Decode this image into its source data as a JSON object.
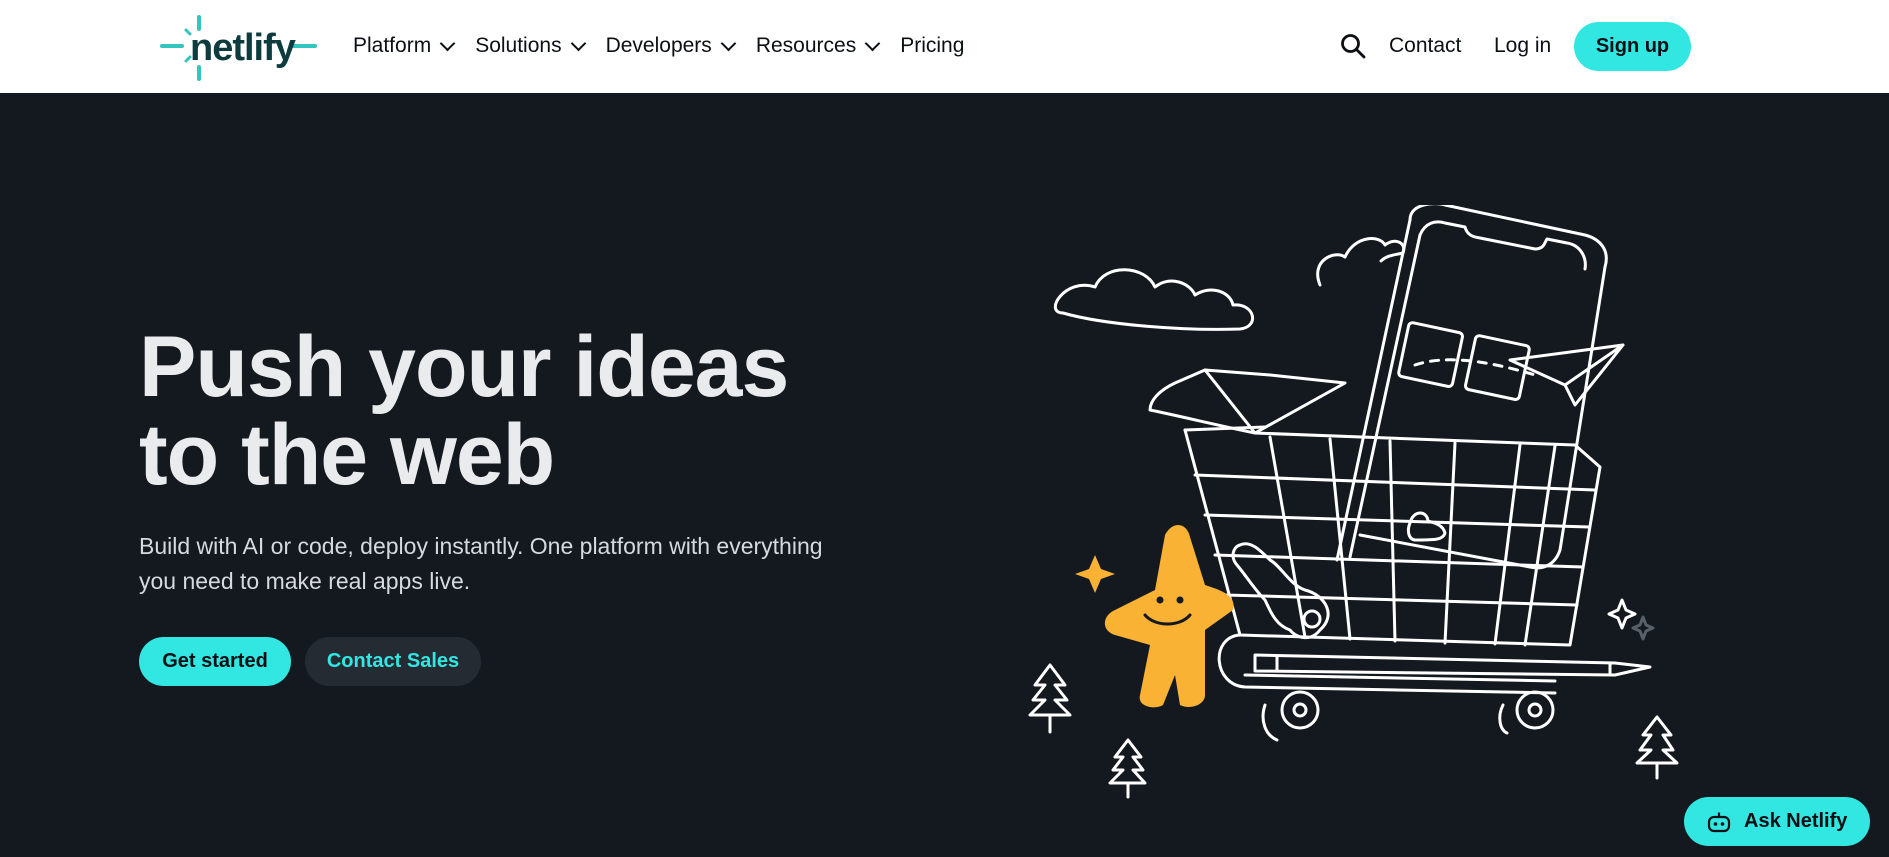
{
  "header": {
    "logo_text": "netlify",
    "nav": [
      {
        "label": "Platform",
        "has_dropdown": true
      },
      {
        "label": "Solutions",
        "has_dropdown": true
      },
      {
        "label": "Developers",
        "has_dropdown": true
      },
      {
        "label": "Resources",
        "has_dropdown": true
      },
      {
        "label": "Pricing",
        "has_dropdown": false
      }
    ],
    "search_icon": "search-icon",
    "contact": "Contact",
    "login": "Log in",
    "signup": "Sign up"
  },
  "hero": {
    "title_line1": "Push your ideas",
    "title_line2": "to the web",
    "subtitle": "Build with AI or code, deploy instantly. One platform with everything you need to make real apps live.",
    "cta_primary": "Get started",
    "cta_secondary": "Contact Sales"
  },
  "assistant": {
    "label": "Ask Netlify",
    "icon": "robot-icon"
  },
  "colors": {
    "accent": "#32e6e2",
    "dark_bg": "#141920",
    "logo_text": "#0d3b3e",
    "mascot": "#f9b233"
  }
}
